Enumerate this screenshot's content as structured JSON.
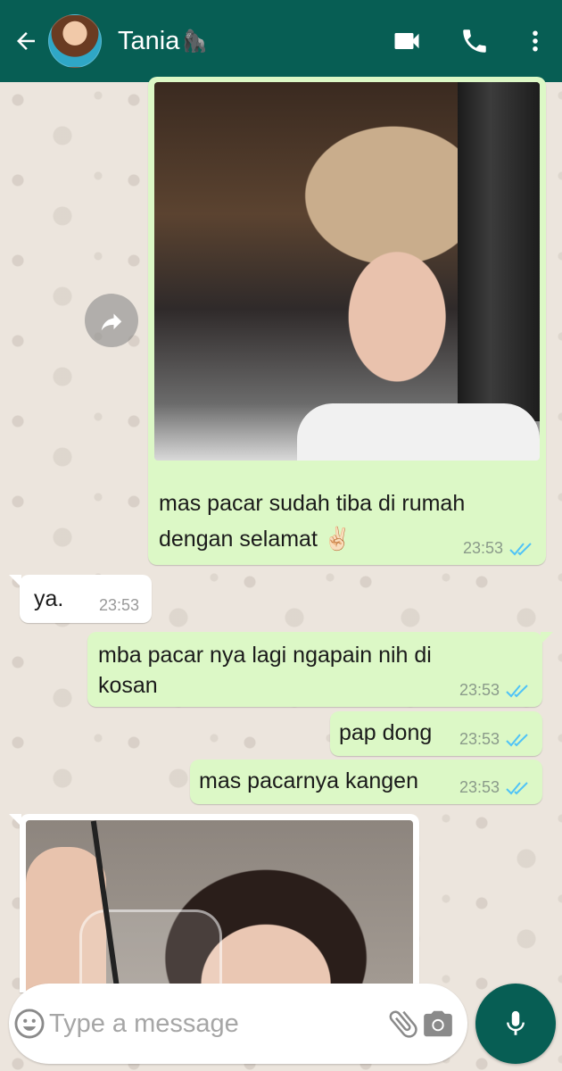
{
  "header": {
    "contact_name": "Tania",
    "contact_emoji": "🦍",
    "icons": [
      "back-arrow-icon",
      "video-call-icon",
      "phone-icon",
      "more-vert-icon"
    ],
    "color": "#075e54"
  },
  "messages": [
    {
      "type": "image",
      "direction": "outgoing",
      "caption_line1": "mas pacar sudah tiba di rumah",
      "caption_line2": "dengan selamat ✌🏻",
      "time": "23:53",
      "status": "read"
    },
    {
      "type": "text",
      "direction": "incoming",
      "text": "ya.",
      "time": "23:53"
    },
    {
      "type": "text",
      "direction": "outgoing",
      "line1": "mba pacar nya lagi ngapain nih di",
      "line2": "kosan",
      "time": "23:53",
      "status": "read"
    },
    {
      "type": "text",
      "direction": "outgoing",
      "text": "pap dong",
      "time": "23:53",
      "status": "read"
    },
    {
      "type": "text",
      "direction": "outgoing",
      "text": "mas pacarnya kangen",
      "time": "23:53",
      "status": "read"
    },
    {
      "type": "image",
      "direction": "incoming"
    }
  ],
  "composer": {
    "placeholder": "Type a message",
    "icons": [
      "emoji-icon",
      "attach-icon",
      "camera-icon",
      "mic-icon"
    ]
  },
  "colors": {
    "outgoing_bubble": "#dcf8c6",
    "incoming_bubble": "#ffffff",
    "read_ticks": "#4fc3f7"
  }
}
